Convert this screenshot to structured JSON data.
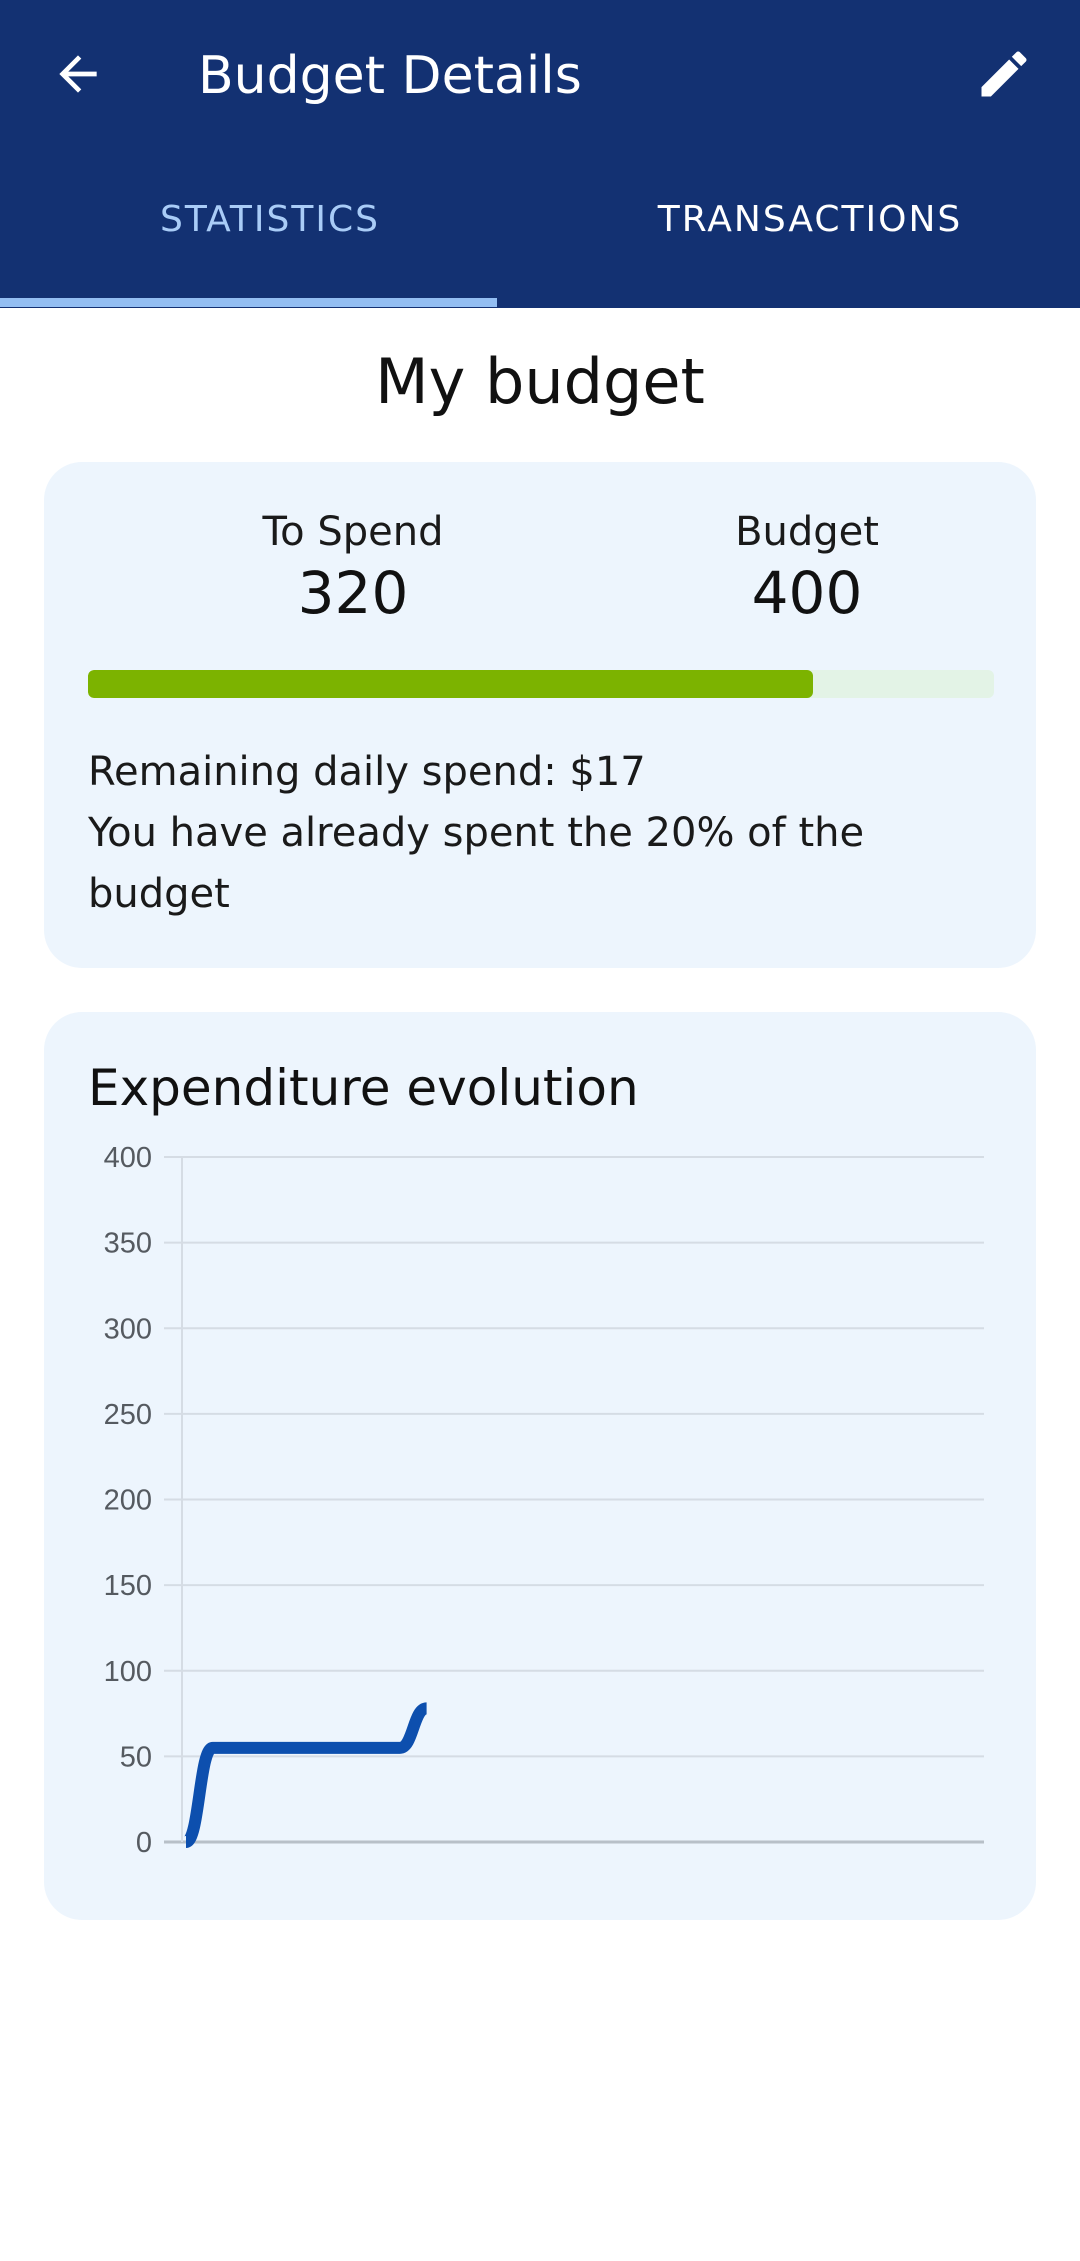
{
  "header": {
    "title": "Budget Details",
    "back_icon": "arrow-left-icon",
    "edit_icon": "pencil-icon"
  },
  "tabs": [
    {
      "label": "STATISTICS",
      "active": true
    },
    {
      "label": "TRANSACTIONS",
      "active": false
    }
  ],
  "page": {
    "heading": "My budget"
  },
  "summary": {
    "to_spend_label": "To Spend",
    "to_spend_value": "320",
    "budget_label": "Budget",
    "budget_value": "400",
    "progress_fraction": 0.8,
    "remaining_text": "Remaining daily spend: $17",
    "spent_text": "You have already spent the 20% of the budget"
  },
  "chart_data": {
    "type": "line",
    "title": "Expenditure evolution",
    "xlabel": "",
    "ylabel": "",
    "ylim": [
      0,
      400
    ],
    "yticks": [
      0,
      50,
      100,
      150,
      200,
      250,
      300,
      350,
      400
    ],
    "grid": true,
    "x": [
      0,
      1,
      2,
      3,
      4,
      5,
      6,
      7,
      8,
      9
    ],
    "xlim": [
      0,
      30
    ],
    "series": [
      {
        "values": [
          0,
          55,
          55,
          55,
          55,
          55,
          55,
          55,
          55,
          78
        ]
      }
    ],
    "colors": {
      "line": "#0d4fae",
      "grid": "#d5dce4",
      "axis": "#b8c0c8"
    }
  },
  "colors": {
    "appbar": "#133172",
    "active_tab": "#a9ccf7",
    "card_bg": "#edf5fd",
    "progress_fill": "#7cb300",
    "progress_track": "#e3f3e6"
  }
}
